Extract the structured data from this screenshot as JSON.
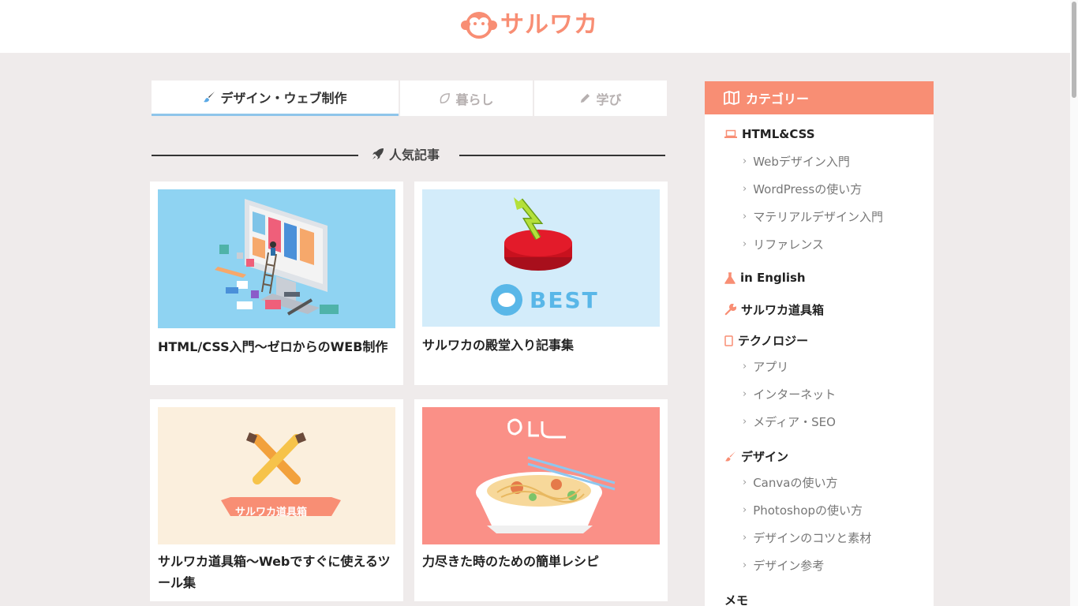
{
  "header": {
    "logo_text": "サルワカ",
    "logo_icon": "monkey-face-icon"
  },
  "tabs": [
    {
      "label": "デザイン・ウェブ制作",
      "icon": "brush-icon",
      "active": true
    },
    {
      "label": "暮らし",
      "icon": "leaf-icon",
      "active": false
    },
    {
      "label": "学び",
      "icon": "pencil-icon",
      "active": false
    }
  ],
  "section": {
    "title": "人気記事",
    "icon": "rocket-icon"
  },
  "articles": [
    {
      "title": "HTML/CSS入門〜ゼロからのWEB制作"
    },
    {
      "title": "サルワカの殿堂入り記事集",
      "image_text": "BEST"
    },
    {
      "title": "サルワカ道具箱〜Webですぐに使えるツール集",
      "image_text": "サルワカ道具箱"
    },
    {
      "title": "力尽きた時のための簡単レシピ"
    }
  ],
  "sidebar": {
    "title": "カテゴリー",
    "title_icon": "map-icon",
    "categories": [
      {
        "label": "HTML&CSS",
        "icon": "laptop-icon",
        "subs": [
          "Webデザイン入門",
          "WordPressの使い方",
          "マテリアルデザイン入門",
          "リファレンス"
        ]
      },
      {
        "label": "in English",
        "icon": "flask-icon",
        "subs": []
      },
      {
        "label": "サルワカ道具箱",
        "icon": "wrench-icon",
        "subs": []
      },
      {
        "label": "テクノロジー",
        "icon": "tablet-icon",
        "subs": [
          "アプリ",
          "インターネット",
          "メディア・SEO"
        ]
      },
      {
        "label": "デザイン",
        "icon": "brush-icon",
        "subs": [
          "Canvaの使い方",
          "Photoshopの使い方",
          "デザインのコツと素材",
          "デザイン参考"
        ]
      },
      {
        "label": "メモ",
        "icon": "",
        "subs": []
      }
    ]
  },
  "colors": {
    "accent": "#f88e74",
    "tab_active_underline": "#8fc5ea",
    "background": "#efebeb"
  }
}
